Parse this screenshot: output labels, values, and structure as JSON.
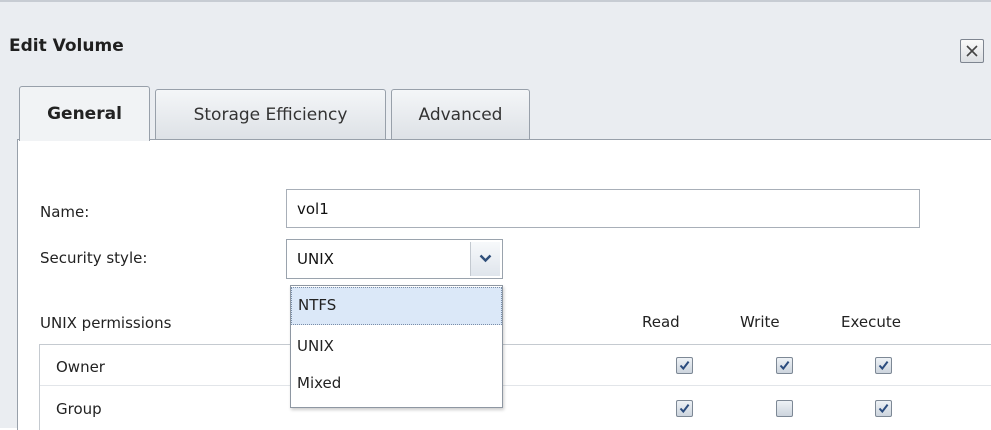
{
  "dialog": {
    "title": "Edit Volume",
    "close_icon": "close-icon"
  },
  "tabs": [
    {
      "label": "General",
      "active": true
    },
    {
      "label": "Storage Efficiency",
      "active": false
    },
    {
      "label": "Advanced",
      "active": false
    }
  ],
  "form": {
    "name_label": "Name:",
    "name_value": "vol1",
    "security_label": "Security style:",
    "security_value": "UNIX",
    "security_options": [
      "NTFS",
      "UNIX",
      "Mixed"
    ],
    "highlighted_option": "NTFS"
  },
  "permissions": {
    "label": "UNIX permissions",
    "columns": [
      "Read",
      "Write",
      "Execute"
    ],
    "rows": [
      {
        "label": "Owner",
        "read": true,
        "write": true,
        "execute": true
      },
      {
        "label": "Group",
        "read": true,
        "write": false,
        "execute": true
      }
    ]
  },
  "colors": {
    "dialog_bg": "#eaedf1",
    "highlight": "#dbe8f8",
    "checkmark": "#2b4c7e"
  }
}
